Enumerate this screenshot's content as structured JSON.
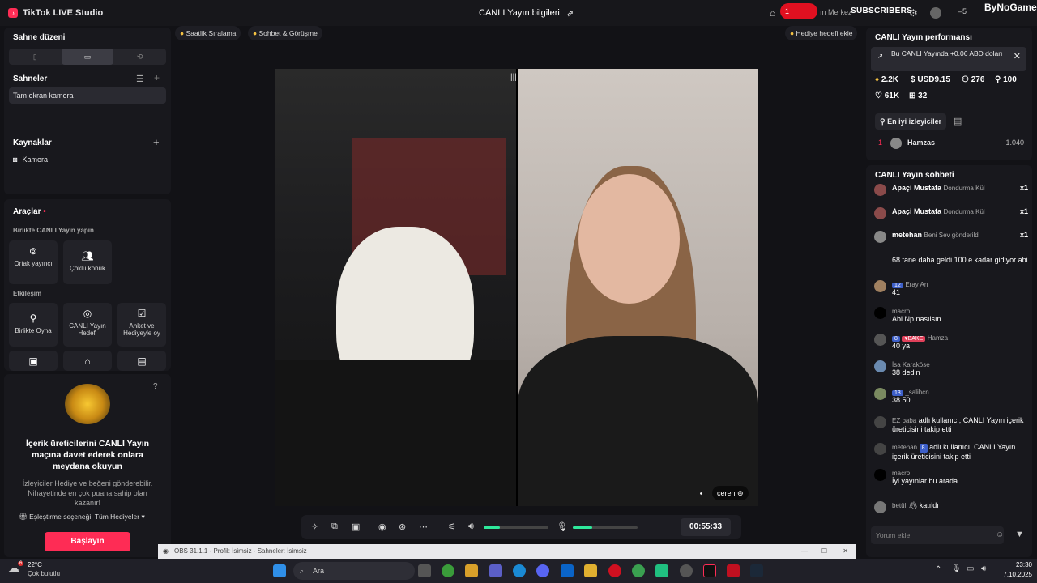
{
  "titlebar": {
    "app_name": "TikTok LIVE Studio",
    "center_title": "CANLI Yayın bilgileri",
    "rec_count": "1",
    "merkez": "ın Merkez",
    "subscribers": "SUBSCRIBERS",
    "count": "5",
    "bynogame": "ByNoGame"
  },
  "left": {
    "stage_title": "Sahne düzeni",
    "scenes_title": "Sahneler",
    "scene_item": "Tam ekran kamera",
    "sources_title": "Kaynaklar",
    "source_item": "Kamera",
    "tools_title": "Araçlar",
    "collab_title": "Birlikte CANLI Yayın yapın",
    "tools": [
      {
        "label": "Ortak yayıncı"
      },
      {
        "label": "Çoklu konuk"
      }
    ],
    "interaction_title": "Etkileşim",
    "interaction": [
      {
        "label": "Birlikte Oyna"
      },
      {
        "label": "CANLI Yayın Hedefi"
      },
      {
        "label": "Anket ve Hediyeyle oy"
      }
    ],
    "promo_title": "İçerik üreticilerini CANLI Yayın maçına davet ederek onlara meydana okuyun",
    "promo_desc": "İzleyiciler Hediye ve beğeni gönderebilir. Nihayetinde en çok puana sahip olan kazanır!",
    "match_option": "Eşleştirme seçeneği: Tüm Hediyeler",
    "start_button": "Başlayın"
  },
  "center": {
    "chip1": "Saatlik Sıralama",
    "chip2": "Sohbet & Görüşme",
    "chip3": "Hediye hedefi ekle",
    "guest_name": "ceren",
    "timer": "00:55:33",
    "obs_title": "OBS 31.1.1 - Profil: İsimsiz - Sahneler: İsimsiz",
    "mic_level": 0.3,
    "volume_level": 0.25
  },
  "right": {
    "perf_title": "CANLI Yayın performansı",
    "notice": "Bu CANLI Yayında +0.06 ABD doları",
    "stats": {
      "diamonds": "2.2K",
      "usd": "USD9.15",
      "viewers": "276",
      "followers": "100",
      "likes": "61K",
      "gifts": "32"
    },
    "top_viewers_tab": "En iyi izleyiciler",
    "top_viewer": {
      "rank": "1",
      "name": "Hamzas",
      "score": "1.040"
    },
    "chat_title": "CANLI Yayın sohbeti",
    "gifts": [
      {
        "name": "Apaçi Mustafa",
        "gift": "Dondurma Kül",
        "count": "x1"
      },
      {
        "name": "Apaçi Mustafa",
        "gift": "Dondurma Kül",
        "count": "x1"
      },
      {
        "name": "metehan",
        "gift": "Beni Sev gönderildi",
        "count": "x1"
      }
    ],
    "messages": [
      {
        "name": "",
        "badge": "",
        "text": "68 tane daha geldi 100 e kadar gidiyor abi"
      },
      {
        "name": "Eray Arı",
        "badge": "12",
        "text": "41"
      },
      {
        "name": "macro",
        "badge": "",
        "text": "Abi Np nasılsın"
      },
      {
        "name": "Hamza",
        "badge": "8",
        "text": "40 ya"
      },
      {
        "name": "İsa Karaköse",
        "badge": "",
        "text": "38 dedin"
      },
      {
        "name": "_salihcn",
        "badge": "13",
        "text": "38.50"
      },
      {
        "name": "EZ baba",
        "badge": "",
        "text": "adlı kullanıcı, CANLI Yayın içerik üreticisini takip etti"
      },
      {
        "name": "metehan",
        "badge": "8",
        "text": "adlı kullanıcı, CANLI Yayın içerik üreticisini takip etti"
      },
      {
        "name": "macro",
        "badge": "",
        "text": "İyi yayınlar bu arada"
      },
      {
        "name": "betül",
        "badge": "",
        "text": "katıldı"
      }
    ],
    "comment_placeholder": "Yorum ekle"
  },
  "taskbar": {
    "temp": "22°C",
    "weather": "Çok bulutlu",
    "weather_badge": "6",
    "search": "Ara",
    "time": "23:30",
    "date": "7.10.2025"
  }
}
